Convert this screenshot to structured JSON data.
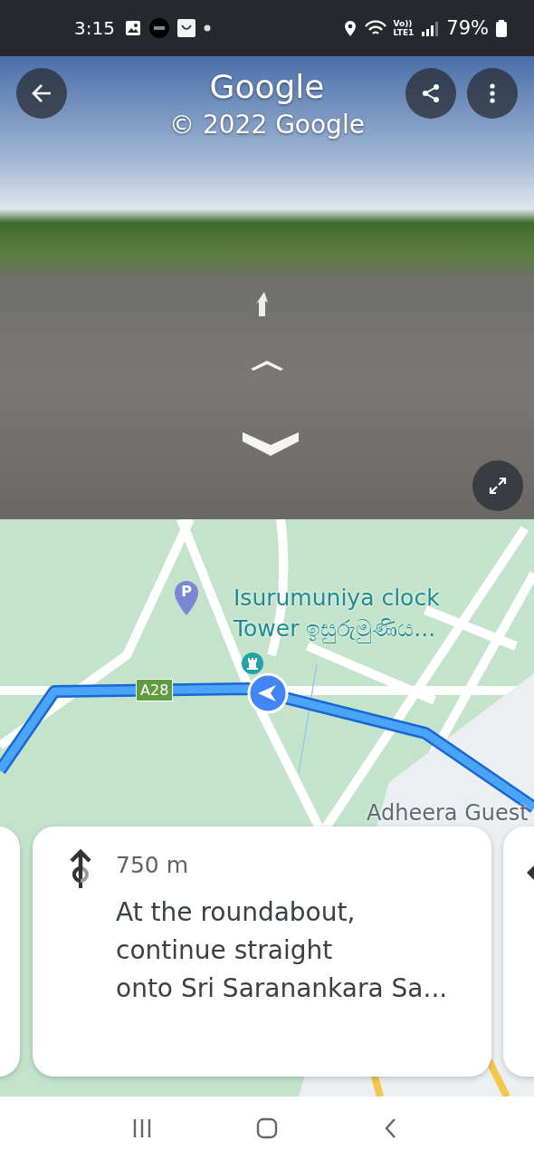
{
  "status_bar": {
    "time": "3:15",
    "voice": "Vo))",
    "network_type": "LTE1",
    "battery": "79%"
  },
  "street_view": {
    "title": "Google",
    "copyright": "© 2022 Google"
  },
  "map": {
    "parking_marker": "P",
    "place_label": "Isurumuniya clock\nTower ඉසුරුමුණිය...",
    "road_badge": "A28",
    "edge_label": "Adheera Guest"
  },
  "directions": [
    {
      "kind": "peek"
    },
    {
      "kind": "step",
      "distance": "750 m",
      "instruction": "At the roundabout,\ncontinue straight\nonto Sri Saranankara Sa..."
    },
    {
      "kind": "peek"
    }
  ]
}
